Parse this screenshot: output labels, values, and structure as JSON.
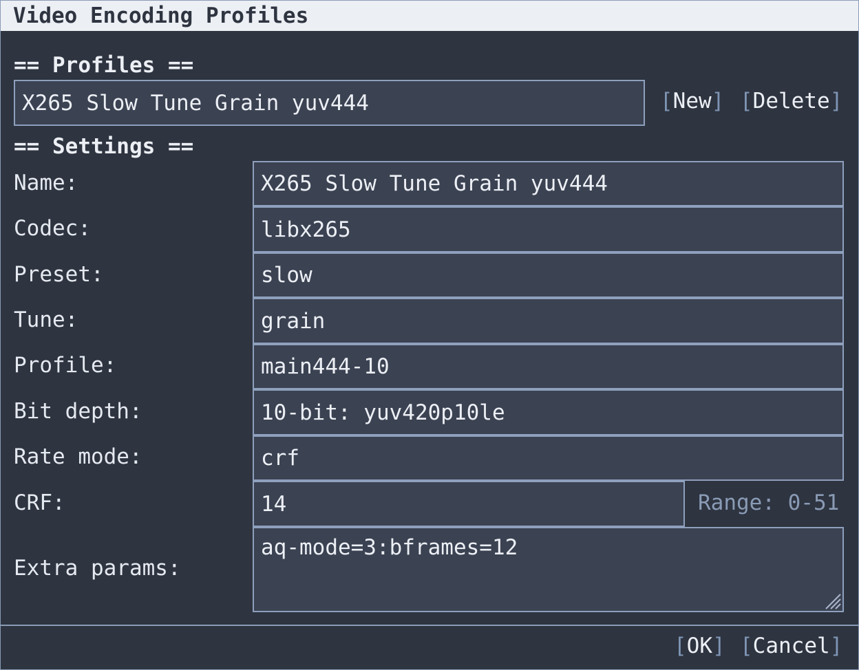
{
  "window": {
    "title": "Video Encoding Profiles"
  },
  "profiles": {
    "heading": "== Profiles ==",
    "selected": "X265 Slow Tune Grain yuv444",
    "new_label": "New",
    "delete_label": "Delete"
  },
  "settings": {
    "heading": "== Settings ==",
    "name": {
      "label": "Name:",
      "value": "X265 Slow Tune Grain yuv444"
    },
    "codec": {
      "label": "Codec:",
      "value": "libx265"
    },
    "preset": {
      "label": "Preset:",
      "value": "slow"
    },
    "tune": {
      "label": "Tune:",
      "value": "grain"
    },
    "profile": {
      "label": "Profile:",
      "value": "main444-10"
    },
    "bit_depth": {
      "label": "Bit depth:",
      "value": "10-bit: yuv420p10le"
    },
    "rate_mode": {
      "label": "Rate mode:",
      "value": "crf"
    },
    "crf": {
      "label": "CRF:",
      "value": "14",
      "range_hint": "Range: 0-51"
    },
    "extra_params": {
      "label": "Extra params:",
      "value": "aq-mode=3:bframes=12"
    }
  },
  "footer": {
    "ok_label": "OK",
    "cancel_label": "Cancel"
  },
  "colors": {
    "background": "#2e3440",
    "field": "#3b4252",
    "border": "#8ea0bd",
    "titlebar": "#eceff4"
  }
}
